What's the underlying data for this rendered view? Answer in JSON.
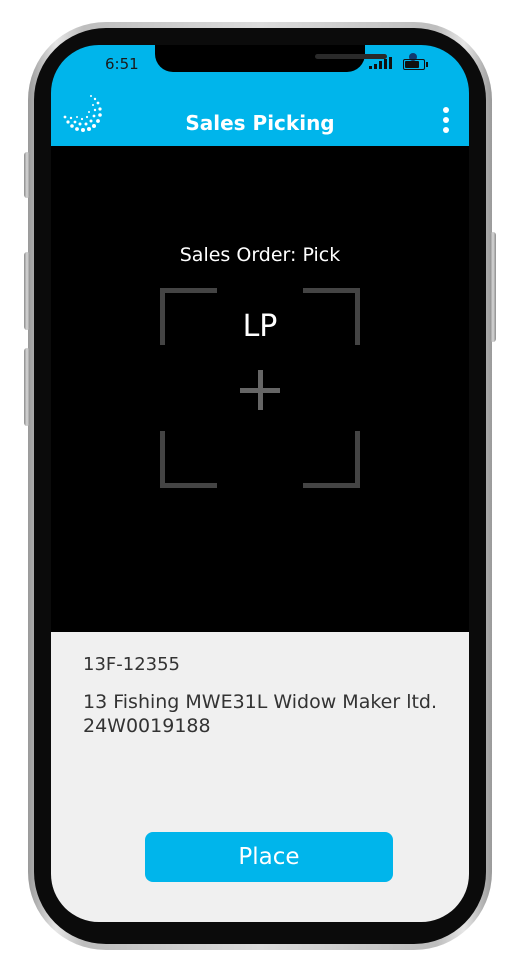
{
  "status_bar": {
    "time": "6:51"
  },
  "app_bar": {
    "title": "Sales Picking"
  },
  "scanner": {
    "heading": "Sales Order: Pick",
    "target_label": "LP"
  },
  "details": {
    "order_id": "13F-12355",
    "item_line_1": "13 Fishing MWE31L Widow Maker ltd.",
    "item_line_2": "24W0019188"
  },
  "actions": {
    "place_label": "Place"
  },
  "colors": {
    "accent": "#00b5eb",
    "details_bg": "#f0f0f0",
    "scanner_bg": "#000000"
  }
}
